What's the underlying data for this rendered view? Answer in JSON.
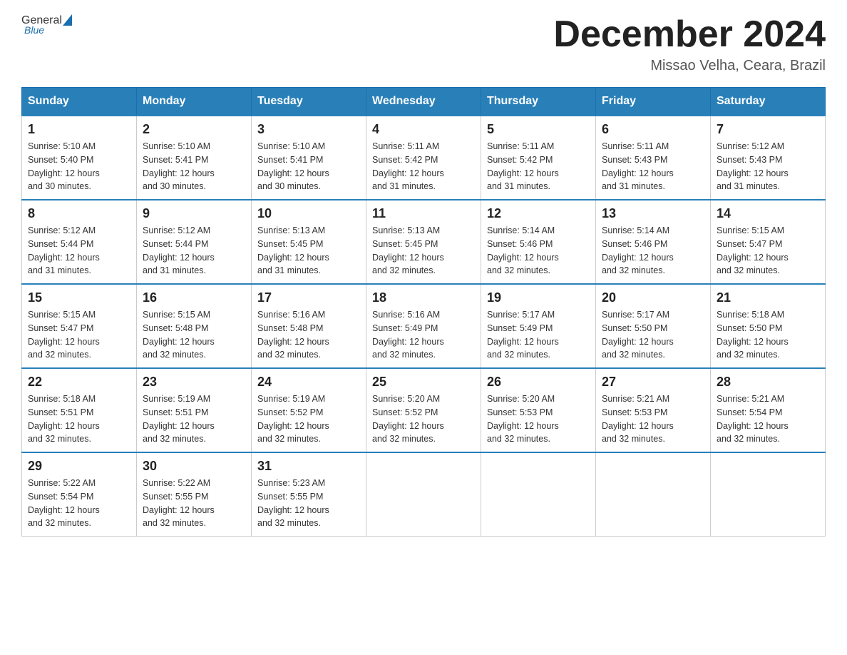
{
  "logo": {
    "general": "General",
    "blue": "Blue"
  },
  "title": "December 2024",
  "subtitle": "Missao Velha, Ceara, Brazil",
  "days_of_week": [
    "Sunday",
    "Monday",
    "Tuesday",
    "Wednesday",
    "Thursday",
    "Friday",
    "Saturday"
  ],
  "weeks": [
    [
      {
        "day": "1",
        "sunrise": "5:10 AM",
        "sunset": "5:40 PM",
        "daylight": "12 hours and 30 minutes."
      },
      {
        "day": "2",
        "sunrise": "5:10 AM",
        "sunset": "5:41 PM",
        "daylight": "12 hours and 30 minutes."
      },
      {
        "day": "3",
        "sunrise": "5:10 AM",
        "sunset": "5:41 PM",
        "daylight": "12 hours and 30 minutes."
      },
      {
        "day": "4",
        "sunrise": "5:11 AM",
        "sunset": "5:42 PM",
        "daylight": "12 hours and 31 minutes."
      },
      {
        "day": "5",
        "sunrise": "5:11 AM",
        "sunset": "5:42 PM",
        "daylight": "12 hours and 31 minutes."
      },
      {
        "day": "6",
        "sunrise": "5:11 AM",
        "sunset": "5:43 PM",
        "daylight": "12 hours and 31 minutes."
      },
      {
        "day": "7",
        "sunrise": "5:12 AM",
        "sunset": "5:43 PM",
        "daylight": "12 hours and 31 minutes."
      }
    ],
    [
      {
        "day": "8",
        "sunrise": "5:12 AM",
        "sunset": "5:44 PM",
        "daylight": "12 hours and 31 minutes."
      },
      {
        "day": "9",
        "sunrise": "5:12 AM",
        "sunset": "5:44 PM",
        "daylight": "12 hours and 31 minutes."
      },
      {
        "day": "10",
        "sunrise": "5:13 AM",
        "sunset": "5:45 PM",
        "daylight": "12 hours and 31 minutes."
      },
      {
        "day": "11",
        "sunrise": "5:13 AM",
        "sunset": "5:45 PM",
        "daylight": "12 hours and 32 minutes."
      },
      {
        "day": "12",
        "sunrise": "5:14 AM",
        "sunset": "5:46 PM",
        "daylight": "12 hours and 32 minutes."
      },
      {
        "day": "13",
        "sunrise": "5:14 AM",
        "sunset": "5:46 PM",
        "daylight": "12 hours and 32 minutes."
      },
      {
        "day": "14",
        "sunrise": "5:15 AM",
        "sunset": "5:47 PM",
        "daylight": "12 hours and 32 minutes."
      }
    ],
    [
      {
        "day": "15",
        "sunrise": "5:15 AM",
        "sunset": "5:47 PM",
        "daylight": "12 hours and 32 minutes."
      },
      {
        "day": "16",
        "sunrise": "5:15 AM",
        "sunset": "5:48 PM",
        "daylight": "12 hours and 32 minutes."
      },
      {
        "day": "17",
        "sunrise": "5:16 AM",
        "sunset": "5:48 PM",
        "daylight": "12 hours and 32 minutes."
      },
      {
        "day": "18",
        "sunrise": "5:16 AM",
        "sunset": "5:49 PM",
        "daylight": "12 hours and 32 minutes."
      },
      {
        "day": "19",
        "sunrise": "5:17 AM",
        "sunset": "5:49 PM",
        "daylight": "12 hours and 32 minutes."
      },
      {
        "day": "20",
        "sunrise": "5:17 AM",
        "sunset": "5:50 PM",
        "daylight": "12 hours and 32 minutes."
      },
      {
        "day": "21",
        "sunrise": "5:18 AM",
        "sunset": "5:50 PM",
        "daylight": "12 hours and 32 minutes."
      }
    ],
    [
      {
        "day": "22",
        "sunrise": "5:18 AM",
        "sunset": "5:51 PM",
        "daylight": "12 hours and 32 minutes."
      },
      {
        "day": "23",
        "sunrise": "5:19 AM",
        "sunset": "5:51 PM",
        "daylight": "12 hours and 32 minutes."
      },
      {
        "day": "24",
        "sunrise": "5:19 AM",
        "sunset": "5:52 PM",
        "daylight": "12 hours and 32 minutes."
      },
      {
        "day": "25",
        "sunrise": "5:20 AM",
        "sunset": "5:52 PM",
        "daylight": "12 hours and 32 minutes."
      },
      {
        "day": "26",
        "sunrise": "5:20 AM",
        "sunset": "5:53 PM",
        "daylight": "12 hours and 32 minutes."
      },
      {
        "day": "27",
        "sunrise": "5:21 AM",
        "sunset": "5:53 PM",
        "daylight": "12 hours and 32 minutes."
      },
      {
        "day": "28",
        "sunrise": "5:21 AM",
        "sunset": "5:54 PM",
        "daylight": "12 hours and 32 minutes."
      }
    ],
    [
      {
        "day": "29",
        "sunrise": "5:22 AM",
        "sunset": "5:54 PM",
        "daylight": "12 hours and 32 minutes."
      },
      {
        "day": "30",
        "sunrise": "5:22 AM",
        "sunset": "5:55 PM",
        "daylight": "12 hours and 32 minutes."
      },
      {
        "day": "31",
        "sunrise": "5:23 AM",
        "sunset": "5:55 PM",
        "daylight": "12 hours and 32 minutes."
      },
      null,
      null,
      null,
      null
    ]
  ],
  "labels": {
    "sunrise": "Sunrise:",
    "sunset": "Sunset:",
    "daylight": "Daylight:"
  }
}
